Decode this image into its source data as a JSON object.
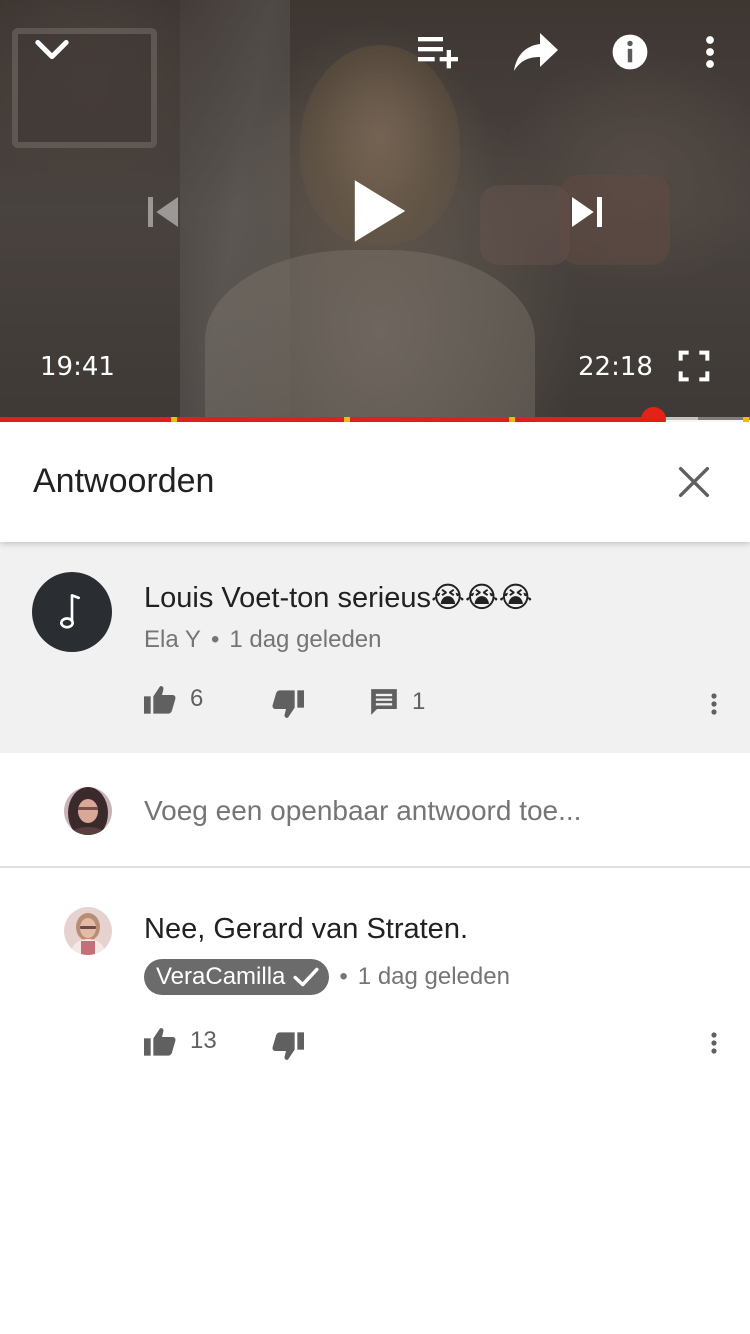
{
  "player": {
    "current_time": "19:41",
    "duration": "22:18",
    "progress_fraction": 0.871,
    "buffered_fraction": 0.93,
    "ad_marker_fractions": [
      0.232,
      0.462,
      0.683,
      0.995
    ],
    "state": "paused",
    "icons": [
      "chevron-down-icon",
      "add-to-queue-icon",
      "share-icon",
      "info-icon",
      "more-vert-icon",
      "previous-icon",
      "play-icon",
      "next-icon",
      "fullscreen-icon"
    ]
  },
  "replies_panel": {
    "title": "Antwoorden",
    "close_icon": "close-icon"
  },
  "parent_comment": {
    "text": "Louis Voet-ton serieus😭😭😭",
    "author": "Ela Y",
    "separator": "•",
    "time": "1 dag geleden",
    "likes": "6",
    "replies": "1",
    "avatar_icon": "music-note-icon"
  },
  "reply_input": {
    "placeholder": "Voeg een openbaar antwoord toe..."
  },
  "replies": [
    {
      "text": "Nee, Gerard van Straten.",
      "author": "VeraCamilla",
      "verified": true,
      "separator": "•",
      "time": "1 dag geleden",
      "likes": "13"
    }
  ],
  "colors": {
    "accent_red": "#e62117",
    "ad_marker": "#f2c200",
    "comment_bg": "#f1f1f1",
    "badge_bg": "#6b6b6b"
  }
}
